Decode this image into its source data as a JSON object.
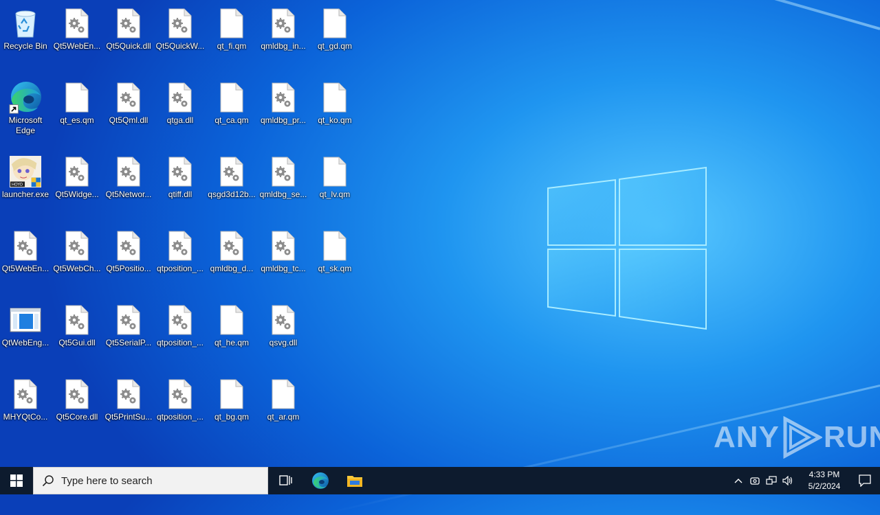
{
  "desktop": {
    "icons": [
      {
        "label": "Recycle Bin",
        "icon": "recycle-bin-icon"
      },
      {
        "label": "Qt5WebEn...",
        "icon": "dll-file-icon"
      },
      {
        "label": "Qt5Quick.dll",
        "icon": "dll-file-icon"
      },
      {
        "label": "Qt5QuickW...",
        "icon": "dll-file-icon"
      },
      {
        "label": "qt_fi.qm",
        "icon": "blank-file-icon"
      },
      {
        "label": "qmldbg_in...",
        "icon": "dll-file-icon"
      },
      {
        "label": "qt_gd.qm",
        "icon": "blank-file-icon"
      },
      {
        "label": "Microsoft Edge",
        "icon": "edge-shortcut-icon"
      },
      {
        "label": "qt_es.qm",
        "icon": "blank-file-icon"
      },
      {
        "label": "Qt5Qml.dll",
        "icon": "dll-file-icon"
      },
      {
        "label": "qtga.dll",
        "icon": "dll-file-icon"
      },
      {
        "label": "qt_ca.qm",
        "icon": "blank-file-icon"
      },
      {
        "label": "qmldbg_pr...",
        "icon": "dll-file-icon"
      },
      {
        "label": "qt_ko.qm",
        "icon": "blank-file-icon"
      },
      {
        "label": "launcher.exe",
        "icon": "launcher-exe-icon"
      },
      {
        "label": "Qt5Widge...",
        "icon": "dll-file-icon"
      },
      {
        "label": "Qt5Networ...",
        "icon": "dll-file-icon"
      },
      {
        "label": "qtiff.dll",
        "icon": "dll-file-icon"
      },
      {
        "label": "qsgd3d12b...",
        "icon": "dll-file-icon"
      },
      {
        "label": "qmldbg_se...",
        "icon": "dll-file-icon"
      },
      {
        "label": "qt_lv.qm",
        "icon": "blank-file-icon"
      },
      {
        "label": "Qt5WebEn...",
        "icon": "dll-file-icon"
      },
      {
        "label": "Qt5WebCh...",
        "icon": "dll-file-icon"
      },
      {
        "label": "Qt5Positio...",
        "icon": "dll-file-icon"
      },
      {
        "label": "qtposition_...",
        "icon": "dll-file-icon"
      },
      {
        "label": "qmldbg_d...",
        "icon": "dll-file-icon"
      },
      {
        "label": "qmldbg_tc...",
        "icon": "dll-file-icon"
      },
      {
        "label": "qt_sk.qm",
        "icon": "blank-file-icon"
      },
      {
        "label": "QtWebEng...",
        "icon": "app-window-icon"
      },
      {
        "label": "Qt5Gui.dll",
        "icon": "dll-file-icon"
      },
      {
        "label": "Qt5SerialP...",
        "icon": "dll-file-icon"
      },
      {
        "label": "qtposition_...",
        "icon": "dll-file-icon"
      },
      {
        "label": "qt_he.qm",
        "icon": "blank-file-icon"
      },
      {
        "label": "qsvg.dll",
        "icon": "dll-file-icon"
      },
      {
        "label": "MHYQtCo...",
        "icon": "dll-file-icon"
      },
      {
        "label": "Qt5Core.dll",
        "icon": "dll-file-icon"
      },
      {
        "label": "Qt5PrintSu...",
        "icon": "dll-file-icon"
      },
      {
        "label": "qtposition_...",
        "icon": "dll-file-icon"
      },
      {
        "label": "qt_bg.qm",
        "icon": "blank-file-icon"
      },
      {
        "label": "qt_ar.qm",
        "icon": "blank-file-icon"
      }
    ]
  },
  "watermark": {
    "left": "ANY",
    "right": "RUN"
  },
  "taskbar": {
    "search_placeholder": "Type here to search",
    "start_icon": "windows-start-icon",
    "task_view_icon": "task-view-icon",
    "pinned": [
      {
        "icon": "edge-icon"
      },
      {
        "icon": "file-explorer-icon"
      }
    ],
    "tray_icons": [
      "chevron-up-icon",
      "meet-now-icon",
      "network-icon",
      "volume-icon"
    ],
    "clock": {
      "time": "4:33 PM",
      "date": "5/2/2024"
    },
    "notification_icon": "action-center-icon"
  }
}
